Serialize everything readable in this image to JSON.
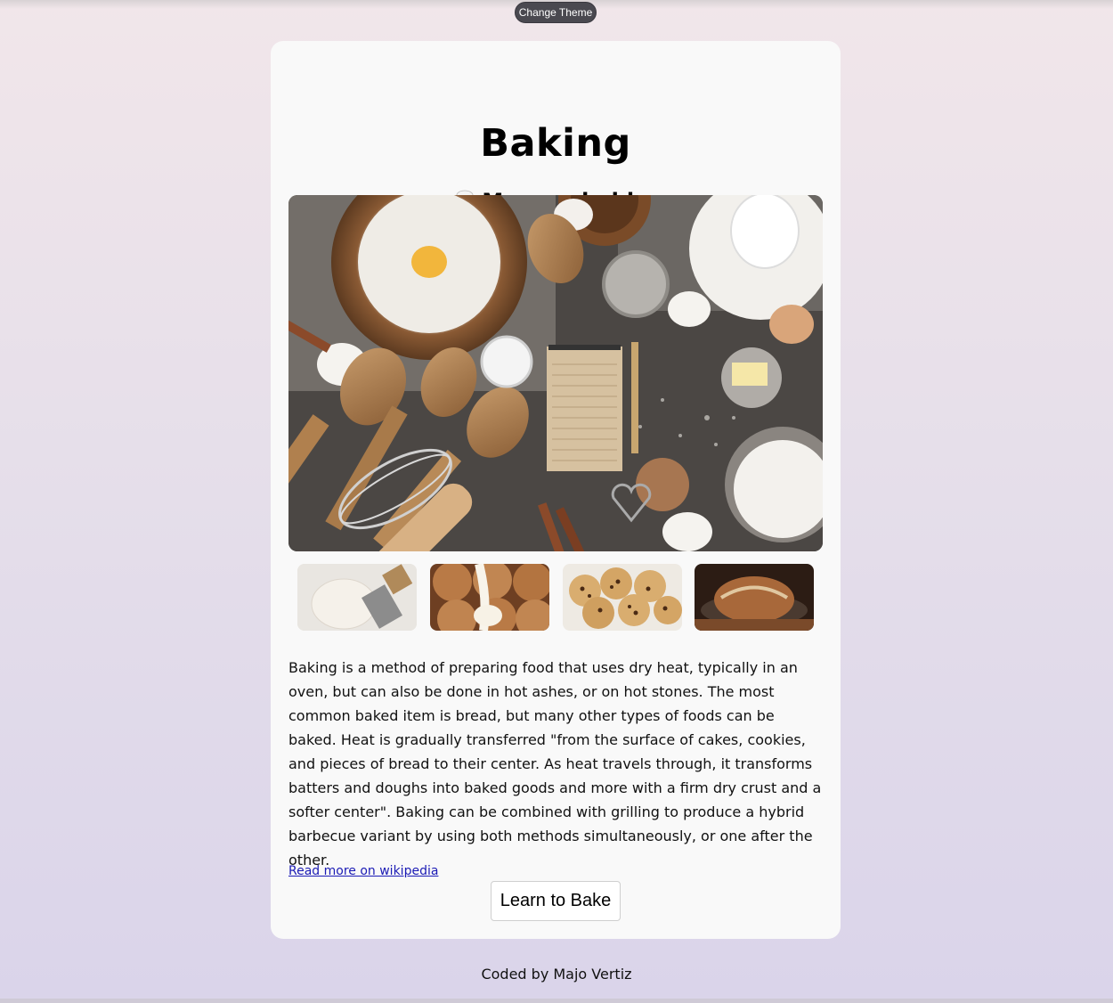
{
  "header": {
    "theme_button": "Change Theme"
  },
  "card": {
    "title": "Baking",
    "subtitle": "My new hobby",
    "hero_image": "baking-ingredients-flatlay",
    "thumbnails": [
      {
        "name": "dough-thumbnail"
      },
      {
        "name": "cinnamon-rolls-thumbnail"
      },
      {
        "name": "cookies-thumbnail"
      },
      {
        "name": "bread-loaf-thumbnail"
      }
    ],
    "description": "Baking is a method of preparing food that uses dry heat, typically in an oven, but can also be done in hot ashes, or on hot stones. The most common baked item is bread, but many other types of foods can be baked. Heat is gradually transferred \"from the surface of cakes, cookies, and pieces of bread to their center. As heat travels through, it transforms batters and doughs into baked goods and more with a firm dry crust and a softer center\". Baking can be combined with grilling to produce a hybrid barbecue variant by using both methods simultaneously, or one after the other.",
    "wiki_link": "Read more on wikipedia",
    "learn_button": "Learn to Bake"
  },
  "footer": {
    "credit": "Coded by Majo Vertiz"
  },
  "colors": {
    "link": "#1b1bb5",
    "theme_button_bg": "#4a4950",
    "card_bg": "#f9f9f9"
  }
}
